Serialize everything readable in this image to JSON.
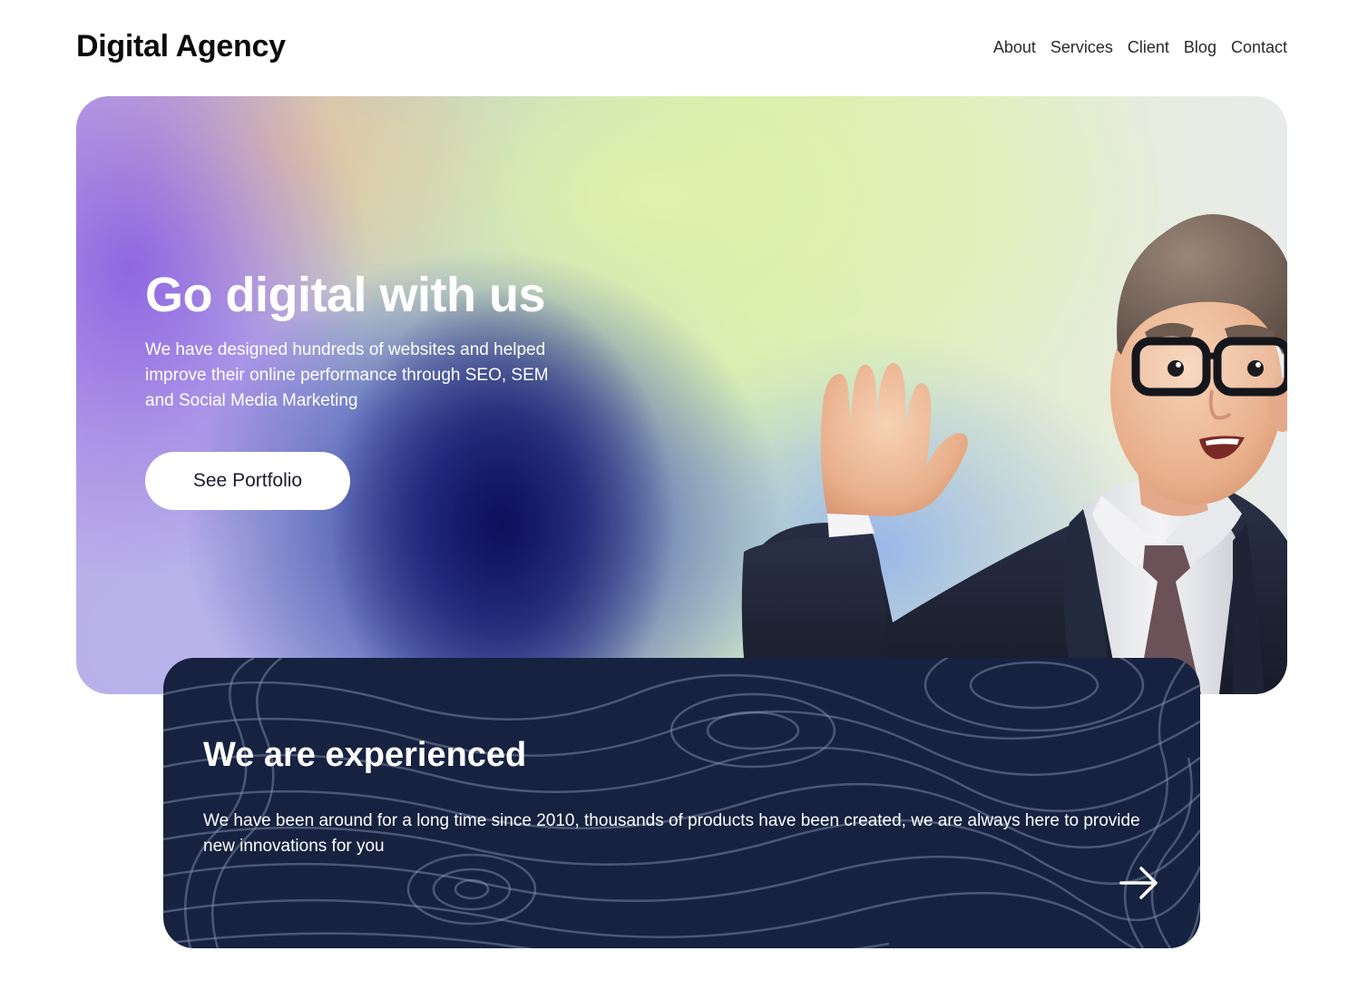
{
  "header": {
    "logo": "Digital Agency",
    "nav": [
      "About",
      "Services",
      "Client",
      "Blog",
      "Contact"
    ]
  },
  "hero": {
    "title": "Go digital with us",
    "description": "We have designed hundreds of websites and helped improve their online performance through SEO, SEM and Social Media Marketing",
    "button_label": "See Portfolio",
    "illustration_icon": "waving-businessman-3d-character"
  },
  "experience_card": {
    "title": "We are experienced",
    "description": "We have been around for a long time since 2010, thousands of products have been created, we are always here to provide new innovations for you",
    "arrow_icon": "arrow-right-icon"
  },
  "colors": {
    "card_background": "#16223f",
    "hero_gradient_dark": "#0c0c5a",
    "hero_gradient_purple": "#8c64e1",
    "hero_gradient_green": "#def2aa",
    "text_dark": "#0b0b0b"
  }
}
